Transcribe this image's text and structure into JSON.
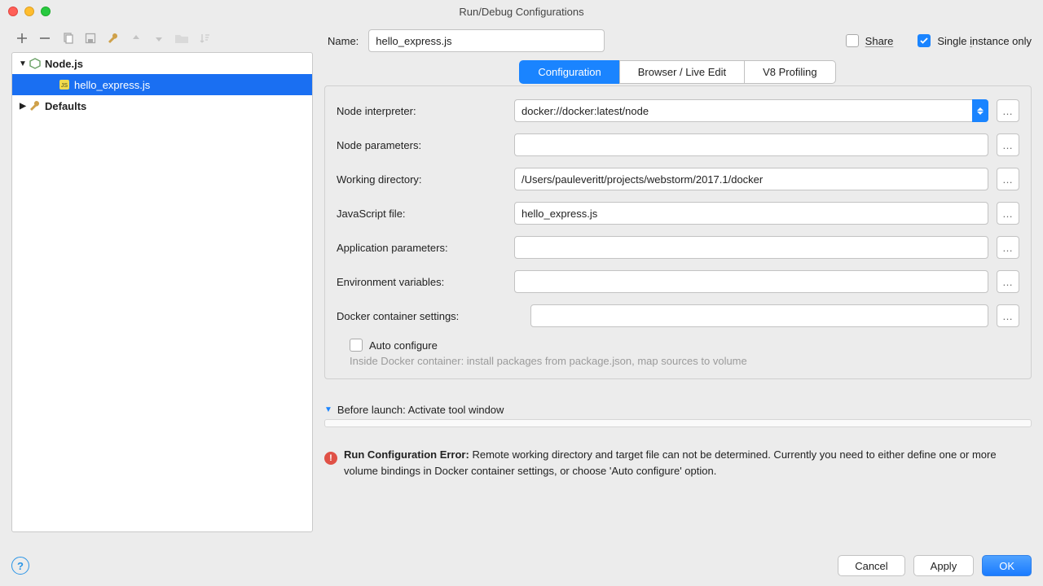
{
  "window": {
    "title": "Run/Debug Configurations"
  },
  "toolbar_icons": [
    "add",
    "remove",
    "copy",
    "save",
    "wrench",
    "up",
    "down",
    "folder",
    "sort"
  ],
  "tree": {
    "parent": {
      "label": "Node.js",
      "expanded": true
    },
    "child": {
      "label": "hello_express.js",
      "selected": true
    },
    "defaults": {
      "label": "Defaults",
      "expanded": false
    }
  },
  "name": {
    "label": "Name:",
    "value": "hello_express.js"
  },
  "share": {
    "label": "Share",
    "checked": false
  },
  "single_instance": {
    "label": "Single instance only",
    "checked": true
  },
  "tabs": {
    "config": "Configuration",
    "browser": "Browser / Live Edit",
    "v8": "V8 Profiling",
    "active": "config"
  },
  "fields": {
    "node_interpreter": {
      "label": "Node interpreter:",
      "value": "docker://docker:latest/node"
    },
    "node_parameters": {
      "label": "Node parameters:",
      "value": ""
    },
    "working_dir": {
      "label": "Working directory:",
      "value": "/Users/pauleveritt/projects/webstorm/2017.1/docker"
    },
    "js_file": {
      "label": "JavaScript file:",
      "value": "hello_express.js"
    },
    "app_params": {
      "label": "Application parameters:",
      "value": ""
    },
    "env_vars": {
      "label": "Environment variables:",
      "value": ""
    },
    "docker_settings": {
      "label": "Docker container settings:",
      "value": ""
    },
    "auto_configure": {
      "label": "Auto configure",
      "checked": false
    },
    "docker_hint": "Inside Docker container: install packages from package.json, map sources to volume"
  },
  "before_launch": {
    "label": "Before launch: Activate tool window"
  },
  "error": {
    "title": "Run Configuration Error:",
    "body": "Remote working directory and target file can not be determined. Currently you need to either define one or more volume bindings in Docker container settings, or choose 'Auto configure' option."
  },
  "buttons": {
    "cancel": "Cancel",
    "apply": "Apply",
    "ok": "OK"
  },
  "browse_ellipsis": "…"
}
